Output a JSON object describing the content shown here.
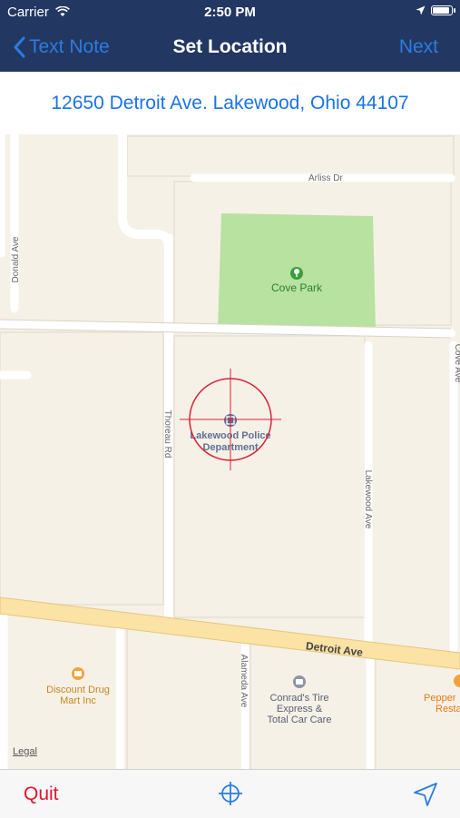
{
  "status_bar": {
    "carrier": "Carrier",
    "time": "2:50 PM"
  },
  "nav": {
    "back_label": "Text Note",
    "title": "Set Location",
    "next_label": "Next"
  },
  "address": "12650 Detroit Ave. Lakewood, Ohio 44107",
  "map": {
    "streets": {
      "arliss": "Arliss Dr",
      "donald": "Donald Ave",
      "thoreau": "Thoreau Rd",
      "lakewood": "Lakewood Ave",
      "cove": "Cove Ave",
      "detroit": "Detroit Ave",
      "alameda": "Alameda Ave"
    },
    "pois": {
      "park": "Cove Park",
      "police_line1": "Lakewood Police",
      "police_line2": "Department",
      "drug_line1": "Discount Drug",
      "drug_line2": "Mart Inc",
      "tire_line1": "Conrad's Tire",
      "tire_line2": "Express &",
      "tire_line3": "Total Car Care",
      "pepper_line1": "Pepper",
      "pepper_line2": "Resta"
    },
    "legal": "Legal"
  },
  "toolbar": {
    "quit_label": "Quit"
  },
  "colors": {
    "nav_bg": "#233763",
    "link_blue": "#2a7de1",
    "quit_red": "#e0162b",
    "crosshair": "#d9233a",
    "park": "#b7e2a0",
    "map_bg": "#f6f1e7"
  },
  "icons": {
    "back": "chevron-left-icon",
    "center": "crosshair-icon",
    "locate": "location-arrow-icon"
  }
}
